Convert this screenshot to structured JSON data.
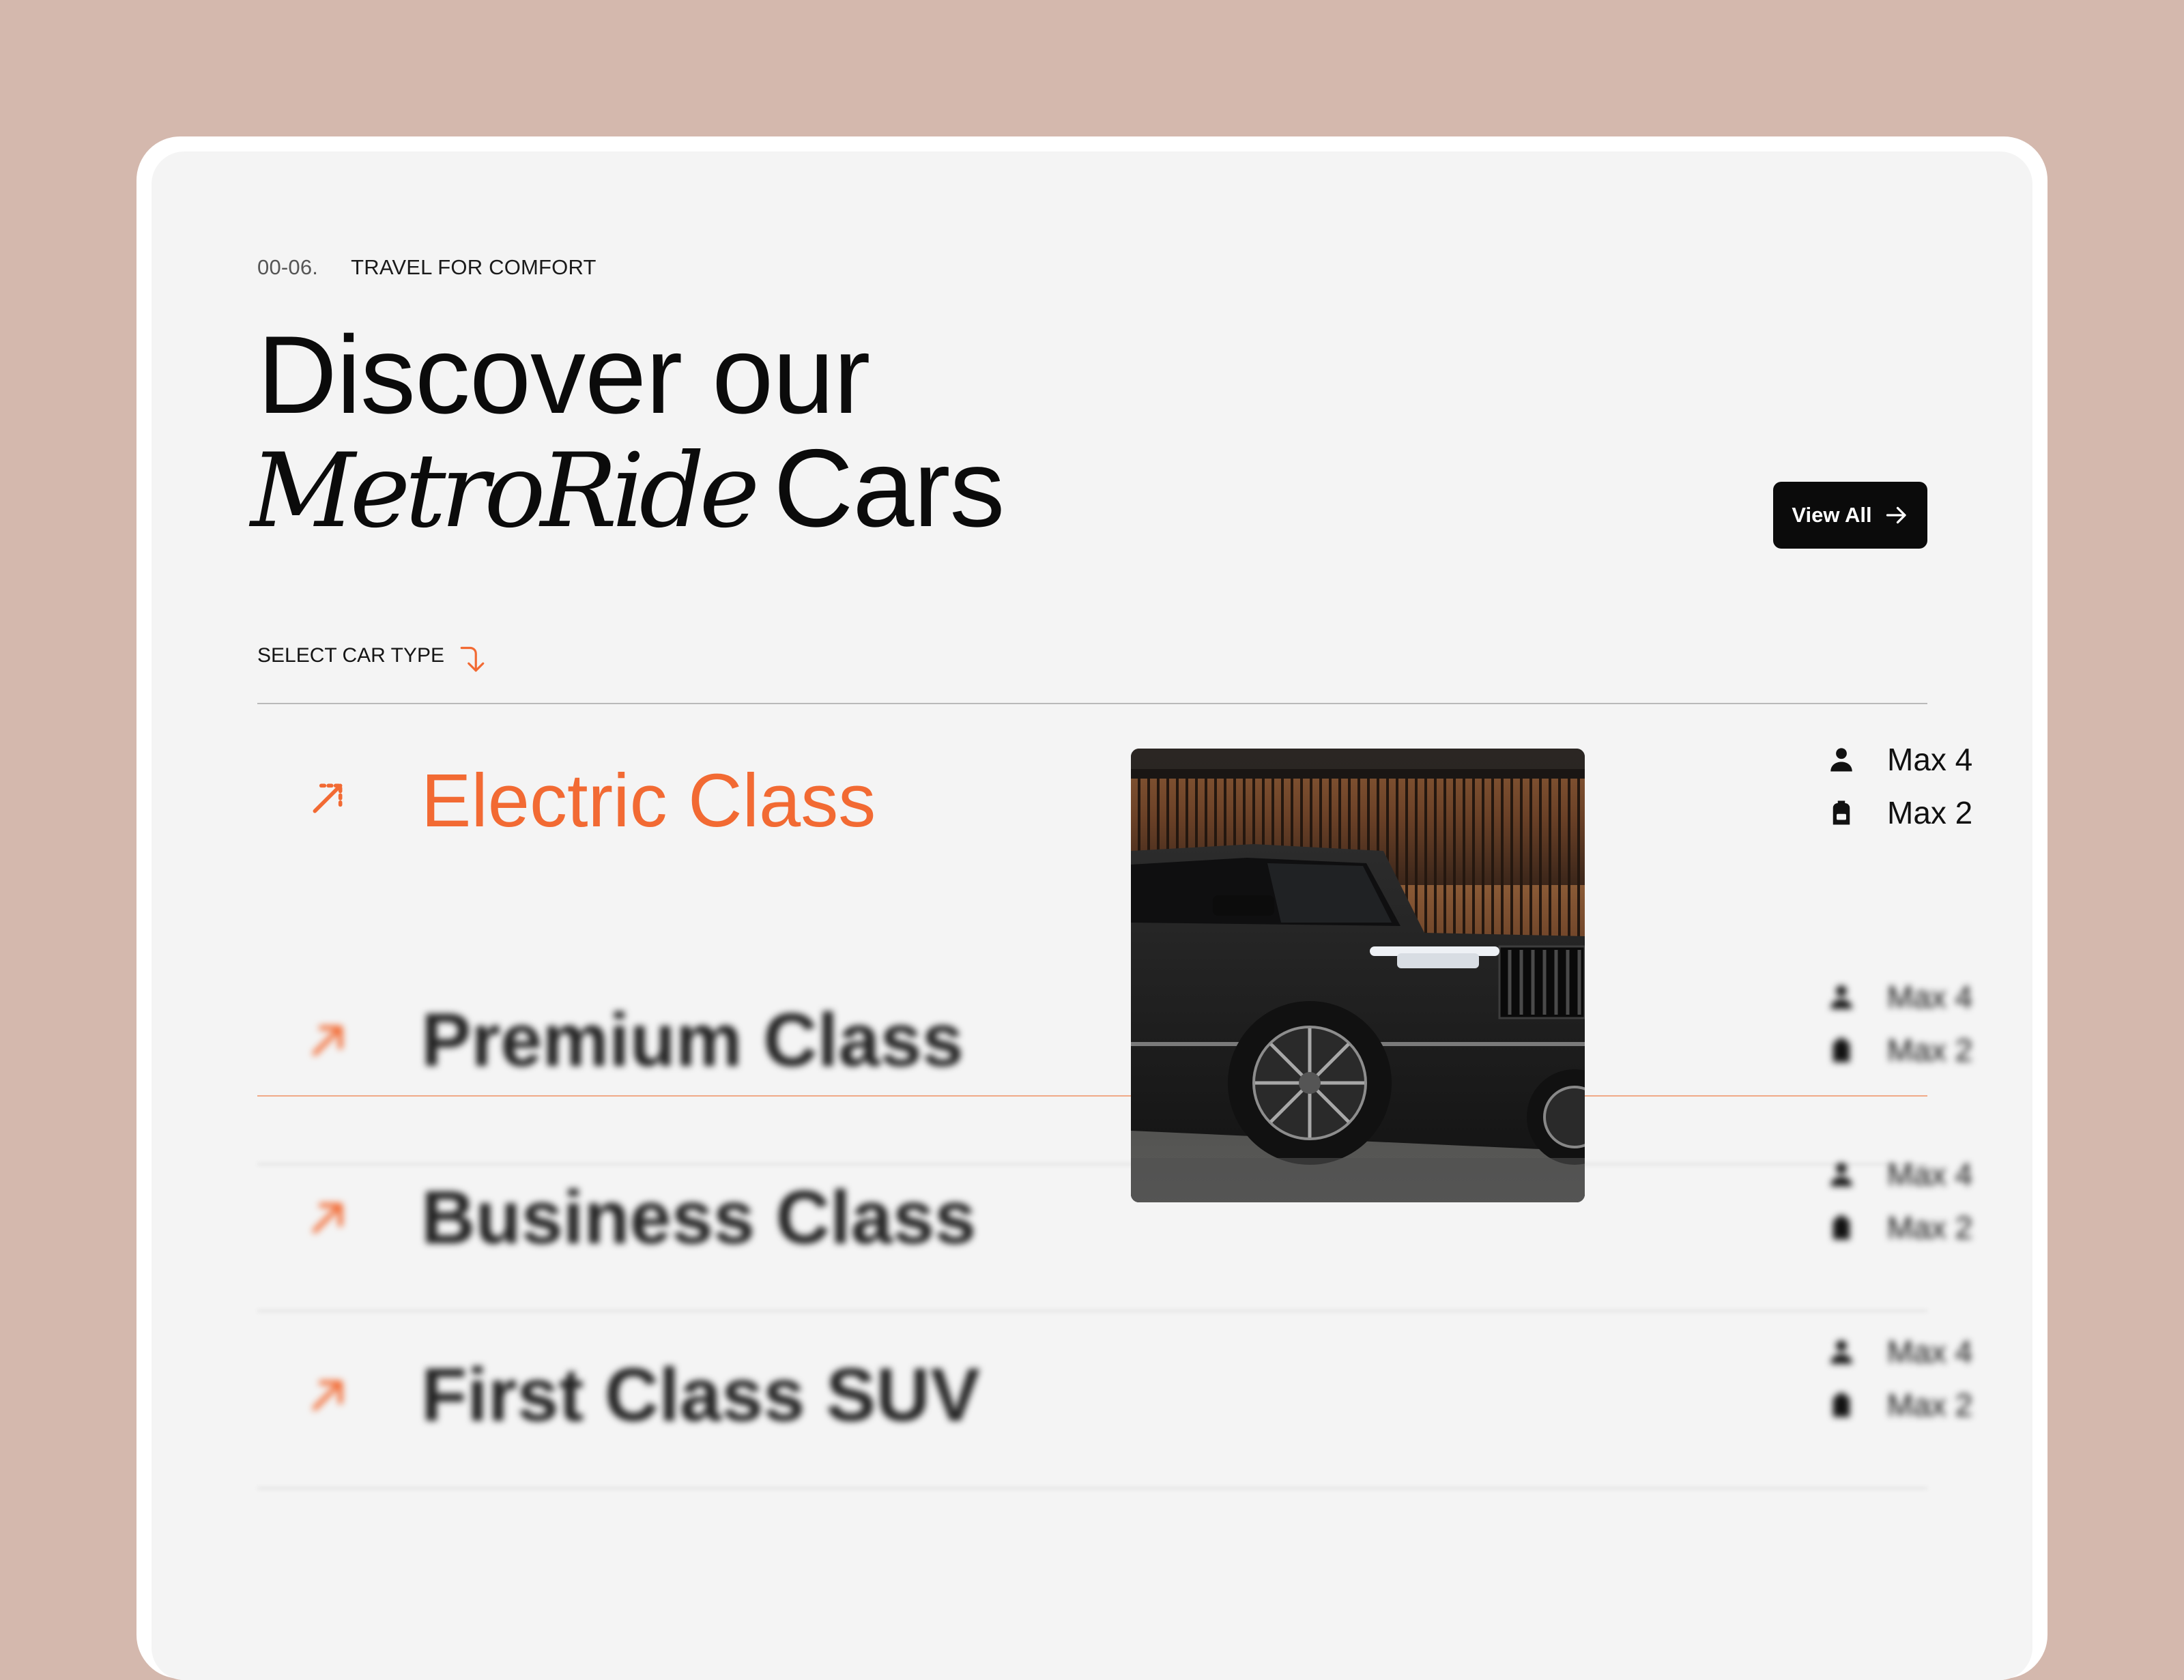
{
  "header": {
    "section_number": "00-06.",
    "section_label": "TRAVEL FOR COMFORT",
    "title_line1": "Discover our",
    "title_brand": "MetroRide",
    "title_line2_suffix": "Cars",
    "view_all_label": "View All",
    "select_label": "SELECT CAR TYPE"
  },
  "car_classes": [
    {
      "name": "Electric Class",
      "passengers": "Max 4",
      "luggage": "Max 2",
      "active": true
    },
    {
      "name": "Premium Class",
      "passengers": "Max 4",
      "luggage": "Max 2",
      "active": false
    },
    {
      "name": "Business Class",
      "passengers": "Max 4",
      "luggage": "Max 2",
      "active": false
    },
    {
      "name": "First Class SUV",
      "passengers": "Max 4",
      "luggage": "Max 2",
      "active": false
    }
  ],
  "icons": {
    "row_arrow": "arrow-up-right-icon",
    "passengers": "person-icon",
    "luggage": "backpack-icon",
    "view_all": "arrow-right-icon",
    "select": "curved-arrow-down-icon"
  },
  "colors": {
    "accent": "#f26a33",
    "background": "#d4b8ad",
    "card": "#f4f4f4",
    "button": "#0b0b0b"
  }
}
